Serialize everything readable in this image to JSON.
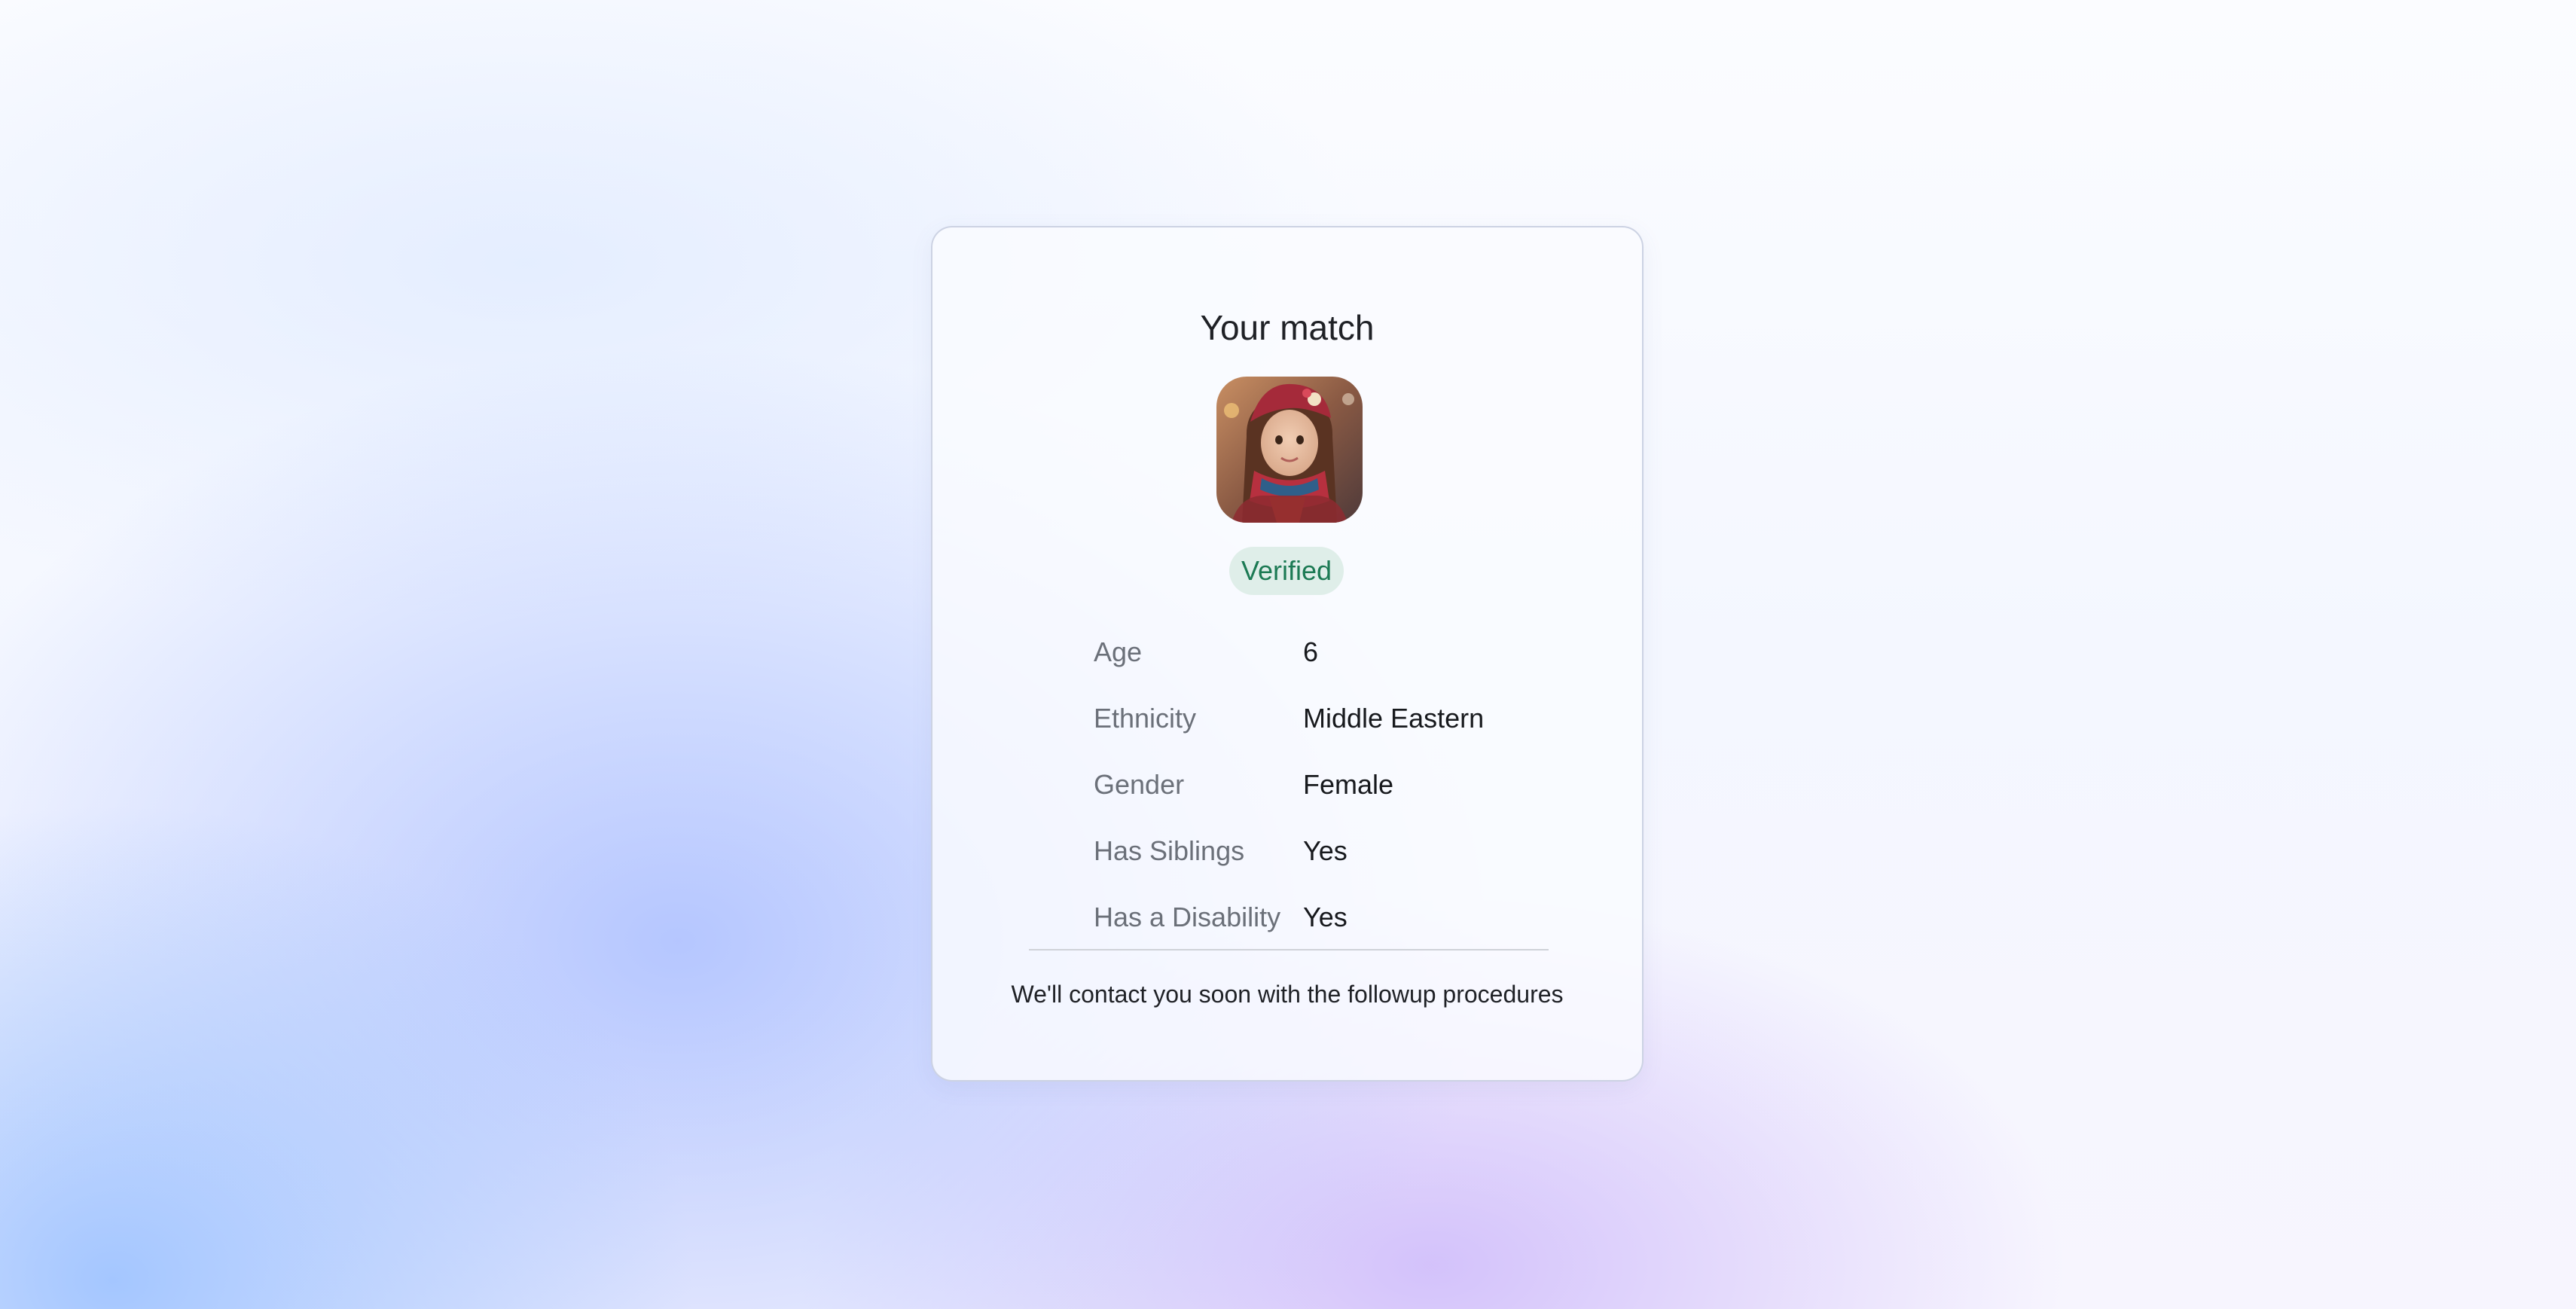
{
  "card": {
    "title": "Your match",
    "badge": "Verified",
    "details": [
      {
        "label": "Age",
        "value": "6"
      },
      {
        "label": "Ethnicity",
        "value": "Middle Eastern"
      },
      {
        "label": "Gender",
        "value": "Female"
      },
      {
        "label": "Has Siblings",
        "value": "Yes"
      },
      {
        "label": "Has a Disability",
        "value": "Yes"
      }
    ],
    "footer": "We'll contact you soon with the followup procedures"
  },
  "colors": {
    "badge_bg": "#dfeee9",
    "badge_text": "#1c7a54",
    "label_text": "#6b7079",
    "value_text": "#17191d"
  }
}
